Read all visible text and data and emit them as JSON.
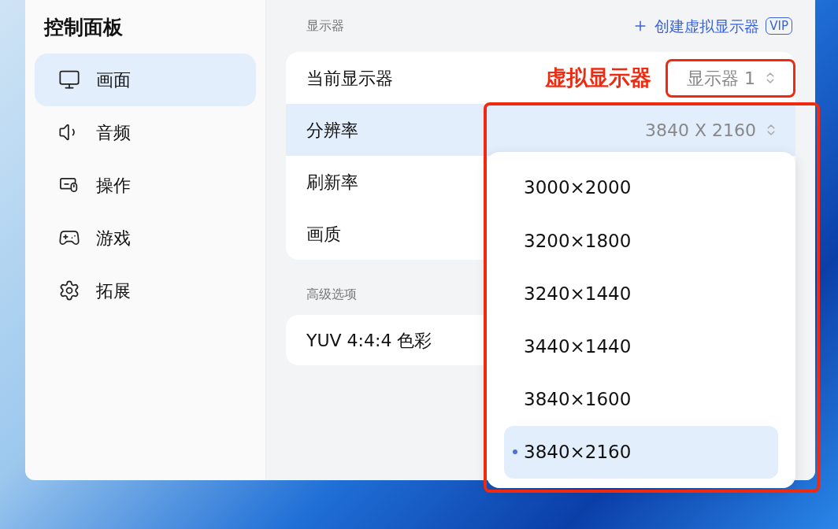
{
  "sidebar": {
    "title": "控制面板",
    "items": [
      {
        "label": "画面",
        "kind": "monitor",
        "selected": true
      },
      {
        "label": "音频",
        "kind": "speaker",
        "selected": false
      },
      {
        "label": "操作",
        "kind": "mouse",
        "selected": false
      },
      {
        "label": "游戏",
        "kind": "gamepad",
        "selected": false
      },
      {
        "label": "拓展",
        "kind": "gear",
        "selected": false
      }
    ]
  },
  "display_section": {
    "heading": "显示器",
    "create_link": "创建虚拟显示器",
    "badge": "VIP",
    "rows": [
      {
        "label": "当前显示器",
        "value": "显示器 1",
        "annotation": "虚拟显示器",
        "selected": false
      },
      {
        "label": "分辨率",
        "value": "3840 X 2160",
        "selected": true
      },
      {
        "label": "刷新率",
        "selected": false
      },
      {
        "label": "画质",
        "selected": false
      }
    ]
  },
  "advanced_section": {
    "heading": "高级选项",
    "rows": [
      {
        "label": "YUV 4:4:4 色彩"
      }
    ]
  },
  "resolution_menu": {
    "options": [
      {
        "label": "3000×2000",
        "selected": false
      },
      {
        "label": "3200×1800",
        "selected": false
      },
      {
        "label": "3240×1440",
        "selected": false
      },
      {
        "label": "3440×1440",
        "selected": false
      },
      {
        "label": "3840×1600",
        "selected": false
      },
      {
        "label": "3840×2160",
        "selected": true
      }
    ]
  }
}
